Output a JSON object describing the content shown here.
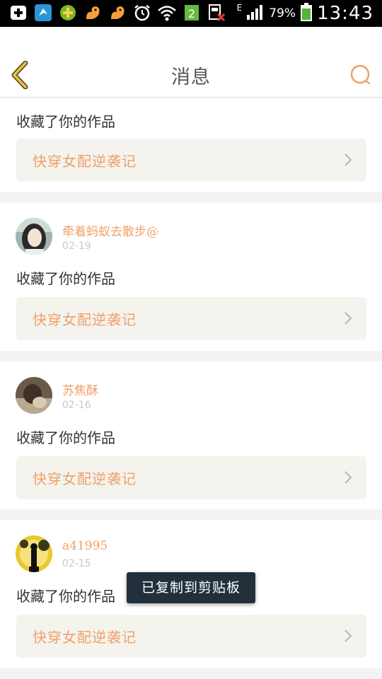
{
  "status_bar": {
    "icons": [
      "plus-box-icon",
      "app-bird-icon",
      "game-icon",
      "squirrel-icon",
      "squirrel-icon",
      "alarm-icon",
      "wifi-icon",
      "sim-2-icon",
      "sim-disabled-icon"
    ],
    "network_label": "E",
    "battery": "79%",
    "time": "13:43",
    "sim_number": "2"
  },
  "header": {
    "title": "消息",
    "back_icon": "chevron-left-icon",
    "search_icon": "search-icon"
  },
  "colors": {
    "accent": "#f0a068",
    "back_arrow": "#e6c24a",
    "work_bg": "#f4f3ee",
    "toast_bg": "#22303c"
  },
  "messages": [
    {
      "action": "收藏了你的作品",
      "work_title": "快穿女配逆袭记"
    },
    {
      "username": "牵着蚂蚁去散步@",
      "date": "02-19",
      "action": "收藏了你的作品",
      "work_title": "快穿女配逆袭记"
    },
    {
      "username": "苏焦酥",
      "date": "02-16",
      "action": "收藏了你的作品",
      "work_title": "快穿女配逆袭记"
    },
    {
      "username": "a41995",
      "date": "02-15",
      "action": "收藏了你的作品",
      "work_title": "快穿女配逆袭记"
    }
  ],
  "toast": "已复制到剪贴板"
}
